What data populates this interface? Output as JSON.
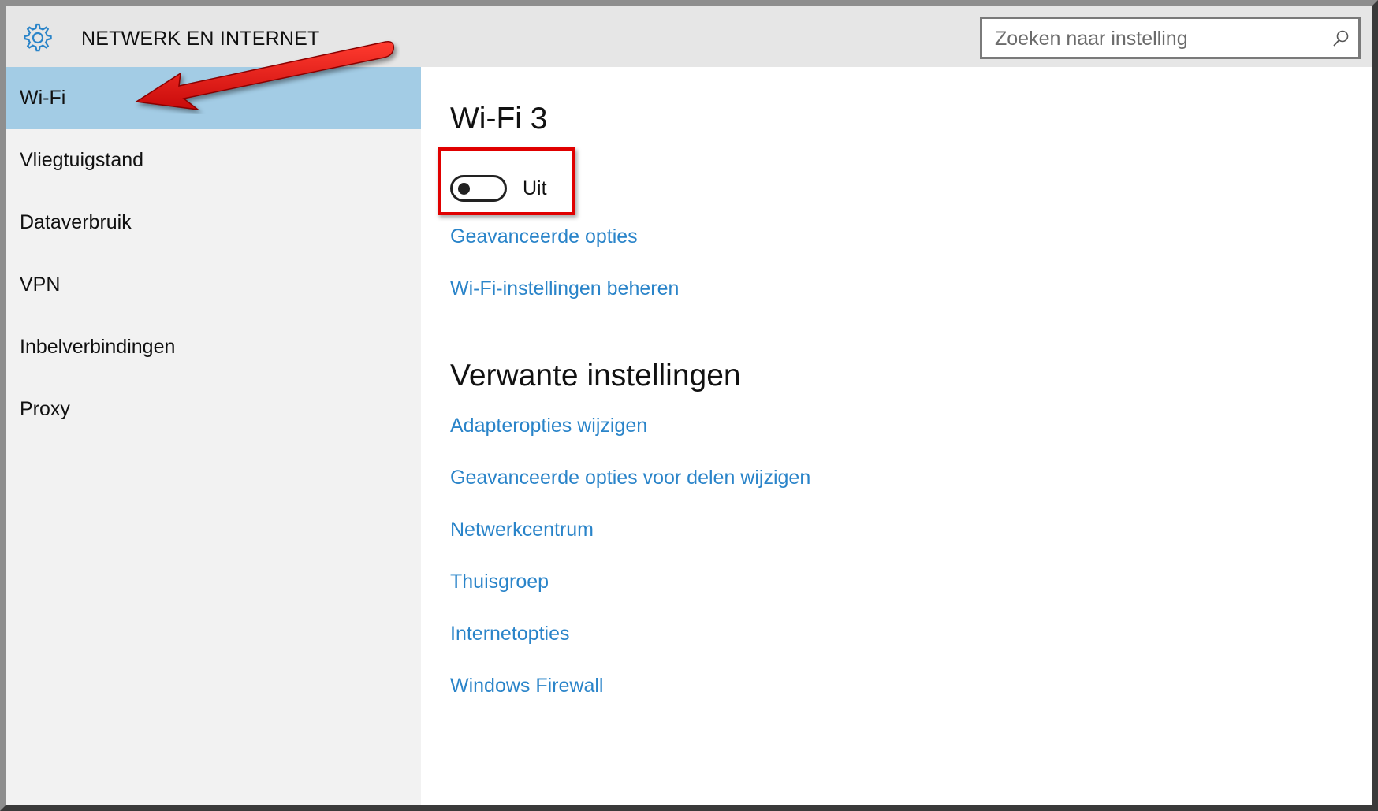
{
  "header": {
    "icon": "gear-icon",
    "title": "NETWERK EN INTERNET",
    "search_placeholder": "Zoeken naar instelling",
    "search_icon": "search-icon"
  },
  "sidebar": {
    "items": [
      {
        "label": "Wi-Fi",
        "selected": true
      },
      {
        "label": "Vliegtuigstand",
        "selected": false
      },
      {
        "label": "Dataverbruik",
        "selected": false
      },
      {
        "label": "VPN",
        "selected": false
      },
      {
        "label": "Inbelverbindingen",
        "selected": false
      },
      {
        "label": "Proxy",
        "selected": false
      }
    ]
  },
  "main": {
    "section_title": "Wi-Fi 3",
    "toggle": {
      "state": "off",
      "label": "Uit"
    },
    "links": [
      "Geavanceerde opties",
      "Wi-Fi-instellingen beheren"
    ],
    "related_title": "Verwante instellingen",
    "related_links": [
      "Adapteropties wijzigen",
      "Geavanceerde opties voor delen wijzigen",
      "Netwerkcentrum",
      "Thuisgroep",
      "Internetopties",
      "Windows Firewall"
    ]
  },
  "annotations": {
    "arrow_color": "#e01010",
    "highlight_color": "#e00000"
  },
  "colors": {
    "accent": "#2a84c9",
    "selected_bg": "#a3cce5",
    "sidebar_bg": "#f2f2f2",
    "header_bg": "#e6e6e6"
  }
}
